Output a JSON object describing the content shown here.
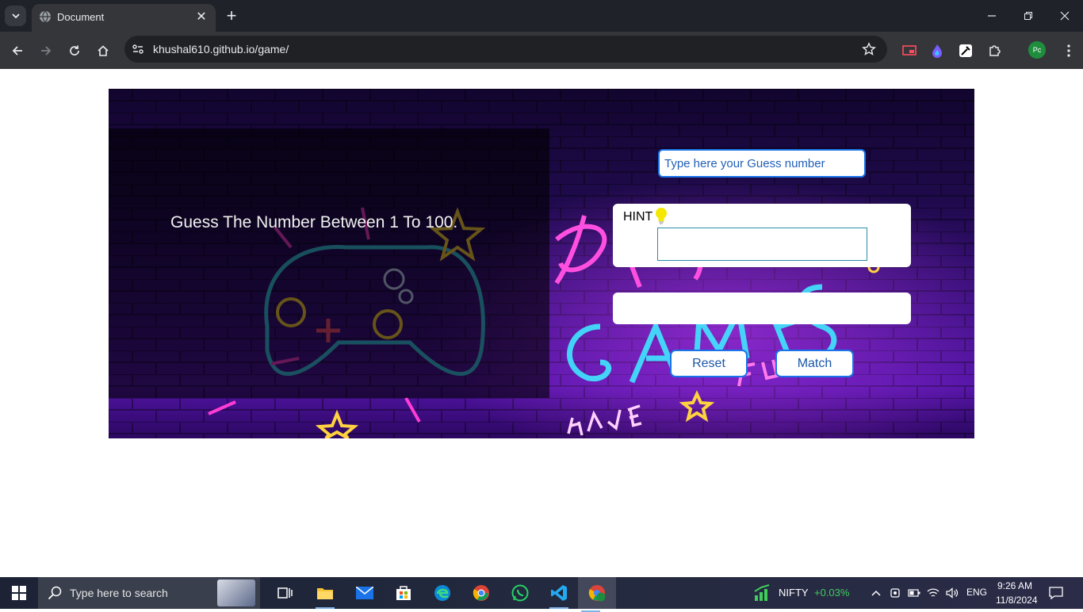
{
  "browser": {
    "tab_title": "Document",
    "url": "khushal610.github.io/game/",
    "profile_initials": "Pc"
  },
  "game": {
    "instruction": "Guess The Number Between 1 To 100.",
    "guess_placeholder": "Type here your Guess number",
    "hint_label": "HINT",
    "reset_label": "Reset",
    "match_label": "Match"
  },
  "taskbar": {
    "search_placeholder": "Type here to search",
    "nifty_label": "NIFTY",
    "nifty_change": "+0.03%",
    "language": "ENG",
    "time": "9:26 AM",
    "date": "11/8/2024"
  },
  "colors": {
    "accent": "#1a73e8",
    "banner_purple": "#3a0f82",
    "neon_pink": "#ff3cd6",
    "neon_cyan": "#3fe8ff",
    "nifty_green": "#3fcf5c"
  }
}
